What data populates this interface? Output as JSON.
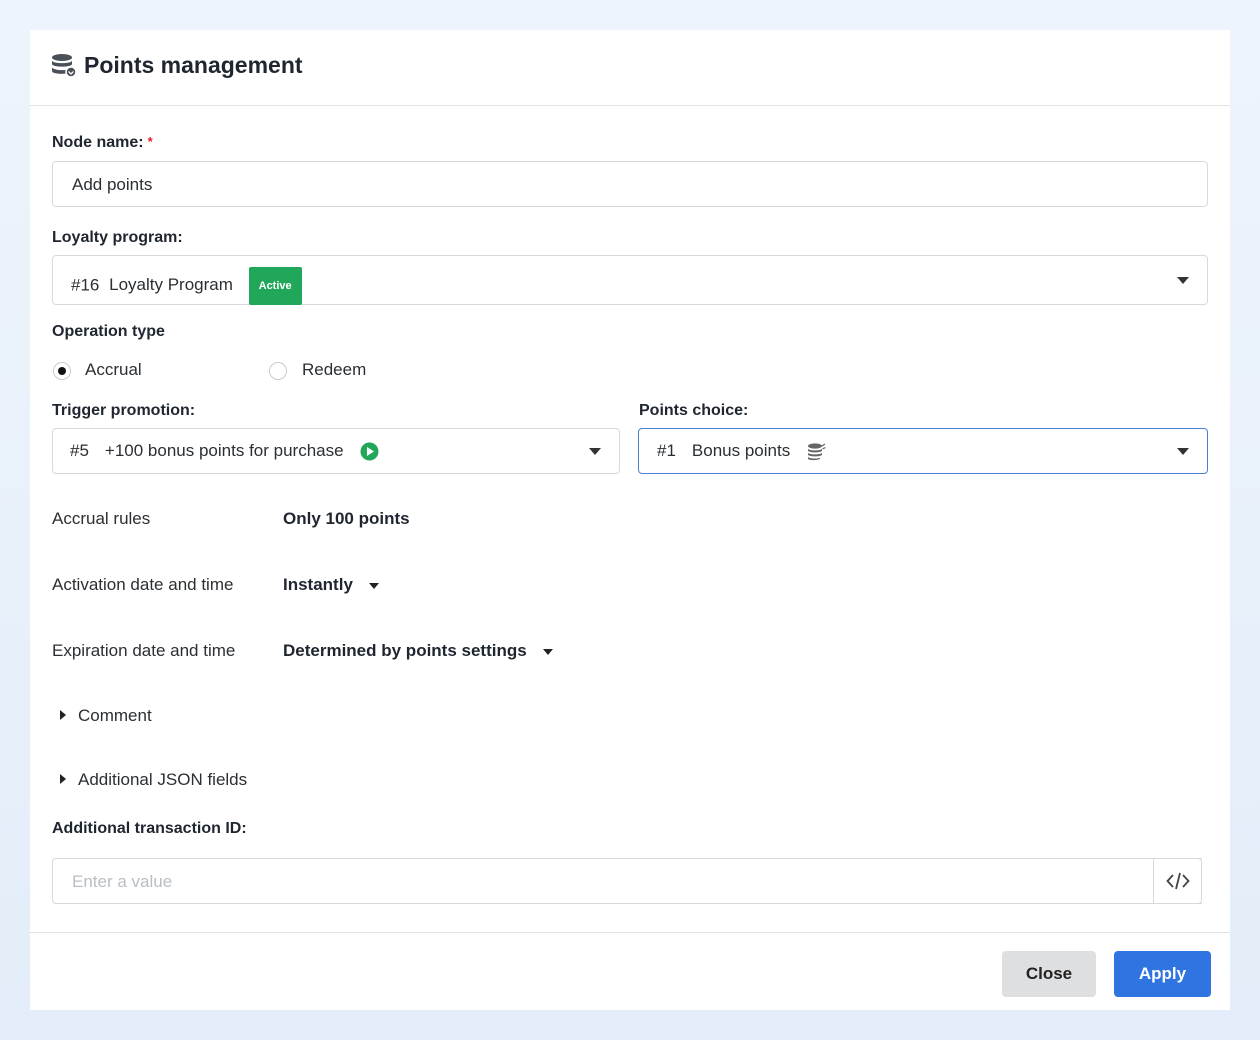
{
  "dialog": {
    "title": "Points management",
    "title_icon": "database-coins-icon"
  },
  "node_name": {
    "label": "Node name:",
    "required_mark": "*",
    "value": "Add points"
  },
  "loyalty_program": {
    "label": "Loyalty program:",
    "id": "#16",
    "name": "Loyalty Program",
    "status": "Active",
    "status_color": "#21a75a"
  },
  "operation_type": {
    "label": "Operation type",
    "options": [
      "Accrual",
      "Redeem"
    ],
    "selected": "Accrual"
  },
  "trigger_promotion": {
    "label": "Trigger promotion:",
    "id": "#5",
    "name": "+100 bonus points for purchase",
    "status_icon": "play-circle-icon"
  },
  "points_choice": {
    "label": "Points choice:",
    "id": "#1",
    "name": "Bonus points",
    "icon": "coins-stack-icon"
  },
  "rules": {
    "accrual_rules_label": "Accrual rules",
    "accrual_rules_value": "Only 100 points",
    "activation_label": "Activation date and time",
    "activation_value": "Instantly",
    "expiration_label": "Expiration date and time",
    "expiration_value": "Determined by points settings"
  },
  "sections": {
    "comment": "Comment",
    "json_fields": "Additional JSON fields"
  },
  "transaction_id": {
    "label": "Additional transaction ID:",
    "placeholder": "Enter a value",
    "code_icon": "code-icon"
  },
  "footer": {
    "close_label": "Close",
    "apply_label": "Apply",
    "apply_color": "#2f74e0"
  }
}
